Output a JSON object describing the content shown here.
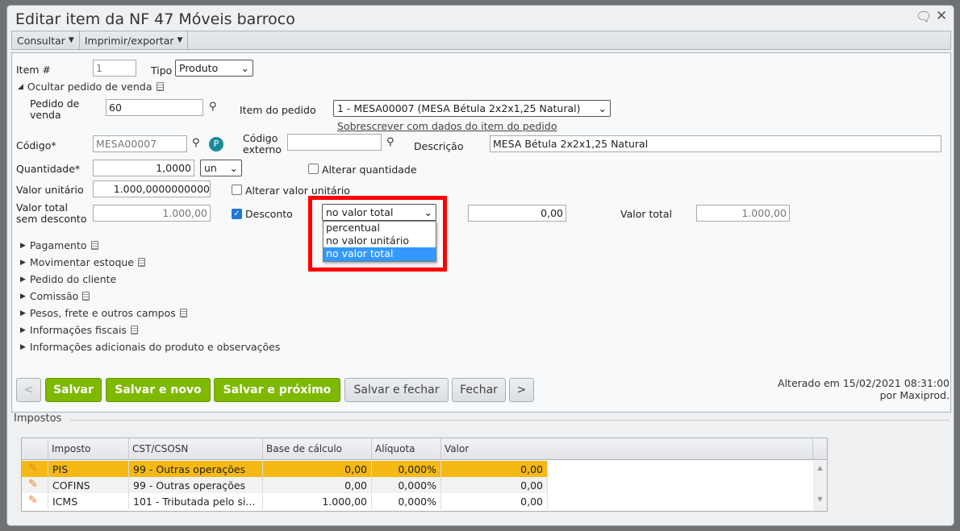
{
  "dialog": {
    "title": "Editar item da NF 47 Móveis barroco",
    "comment_icon": "speech-bubble-icon",
    "close_icon": "close-icon"
  },
  "toolbar": {
    "consultar": "Consultar",
    "imprimir": "Imprimir/exportar"
  },
  "form": {
    "item_label": "Item #",
    "item_value": "1",
    "tipo_label": "Tipo",
    "tipo_value": "Produto",
    "ocultar": "Ocultar pedido de venda",
    "pedido_label": "Pedido de venda",
    "pedido_value": "60",
    "item_pedido_label": "Item do pedido",
    "item_pedido_value": "1 - MESA00007 (MESA Bétula 2x2x1,25 Natural)",
    "sobrescrever": "Sobrescrever com dados do item do pedido",
    "codigo_label": "Código*",
    "codigo_value": "MESA00007",
    "codigo_externo_label": "Código externo",
    "codigo_externo_value": "",
    "descricao_label": "Descrição",
    "descricao_value": "MESA Bétula 2x2x1,25 Natural",
    "quantidade_label": "Quantidade*",
    "quantidade_value": "1,0000",
    "unidade_value": "un",
    "alterar_quantidade": "Alterar quantidade",
    "valor_unitario_label": "Valor unitário",
    "valor_unitario_value": "1.000,0000000000",
    "alterar_valor_unitario": "Alterar valor unitário",
    "valor_total_sd_label": "Valor total sem desconto",
    "valor_total_sd_value": "1.000,00",
    "desconto_label": "Desconto",
    "desconto_checked": true,
    "desconto_tipo_value": "no valor total",
    "desconto_options": [
      "percentual",
      "no valor unitário",
      "no valor total"
    ],
    "desconto_value": "0,00",
    "valor_total_label": "Valor total",
    "valor_total_value": "1.000,00"
  },
  "sections": [
    "Pagamento",
    "Movimentar estoque",
    "Pedido do cliente",
    "Comissão",
    "Pesos, frete e outros campos",
    "Informações fiscais",
    "Informações adicionais do produto e observações"
  ],
  "buttons": {
    "prev": "<",
    "salvar": "Salvar",
    "salvar_novo": "Salvar e novo",
    "salvar_proximo": "Salvar e próximo",
    "salvar_fechar": "Salvar e fechar",
    "fechar": "Fechar",
    "next": ">"
  },
  "status": {
    "line1": "Alterado em 15/02/2021 08:31:00",
    "line2": "por Maxiprod."
  },
  "impostos": {
    "title": "Impostos",
    "columns": [
      "Imposto",
      "CST/CSOSN",
      "Base de cálculo",
      "Alíquota",
      "Valor"
    ],
    "rows": [
      [
        "PIS",
        "99 - Outras operações",
        "0,00",
        "0,000%",
        "0,00"
      ],
      [
        "COFINS",
        "99 - Outras operações",
        "0,00",
        "0,000%",
        "0,00"
      ],
      [
        "ICMS",
        "101 - Tributada pelo si...",
        "1.000,00",
        "0,000%",
        "0,00"
      ]
    ]
  },
  "colors": {
    "highlight": "#f4b914",
    "green": "#7fb800",
    "select_blue": "#3399ff",
    "callout_red": "#ff0000"
  }
}
